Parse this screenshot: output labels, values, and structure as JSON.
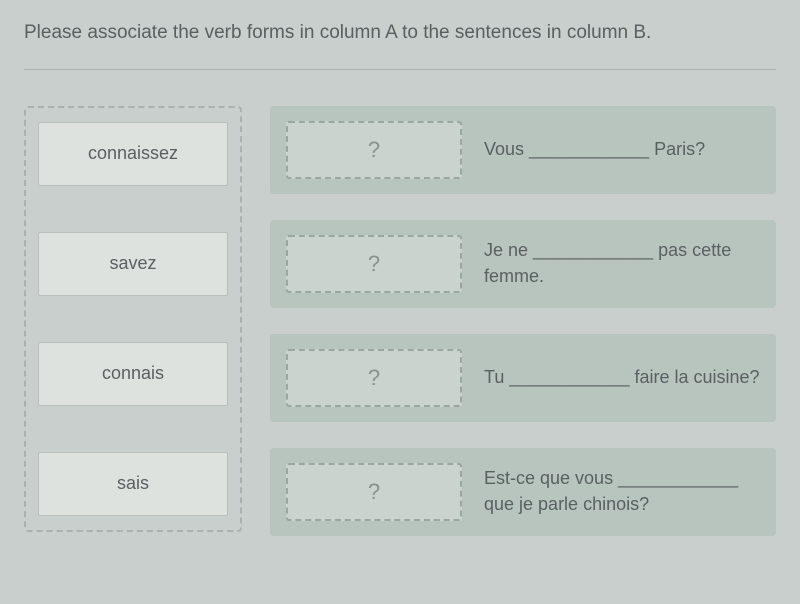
{
  "instruction": "Please associate the verb forms in column A to the sentences in column B.",
  "columnA": {
    "items": [
      {
        "label": "connaissez"
      },
      {
        "label": "savez"
      },
      {
        "label": "connais"
      },
      {
        "label": "sais"
      }
    ]
  },
  "columnB": {
    "placeholder": "?",
    "rows": [
      {
        "sentence": "Vous ____________ Paris?"
      },
      {
        "sentence": "Je ne ____________ pas cette femme."
      },
      {
        "sentence": "Tu ____________ faire la cuisine?"
      },
      {
        "sentence": "Est-ce que vous ____________ que je parle chinois?"
      }
    ]
  }
}
